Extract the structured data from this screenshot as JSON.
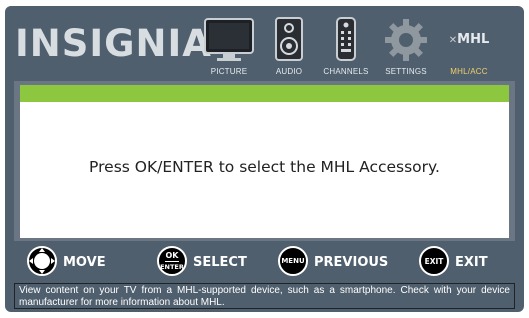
{
  "header": {
    "logo": "INSIGNIA",
    "nav": [
      {
        "label": "PICTURE",
        "icon": "tv-icon",
        "active": false
      },
      {
        "label": "AUDIO",
        "icon": "speaker-icon",
        "active": false
      },
      {
        "label": "CHANNELS",
        "icon": "remote-icon",
        "active": false
      },
      {
        "label": "SETTINGS",
        "icon": "gear-icon",
        "active": false
      },
      {
        "label": "MHL/ACC",
        "icon": "mhl-logo-icon",
        "logo_text": "MHL",
        "active": true
      }
    ]
  },
  "main": {
    "message": "Press OK/ENTER to select the MHL Accessory."
  },
  "buttons": {
    "move": {
      "label": "MOVE"
    },
    "select": {
      "label": "SELECT",
      "key_top": "OK",
      "key_bottom": "ENTER"
    },
    "previous": {
      "label": "PREVIOUS",
      "key": "MENU"
    },
    "exit": {
      "label": "EXIT",
      "key": "EXIT"
    }
  },
  "description": "View content on your TV from a MHL-supported device, such as a smartphone. Check with your device manufacturer for more information about MHL.",
  "colors": {
    "background": "#4f5f6e",
    "accent_green": "#8dc63f",
    "active_label": "#f3d16a",
    "text": "#ffffff"
  }
}
